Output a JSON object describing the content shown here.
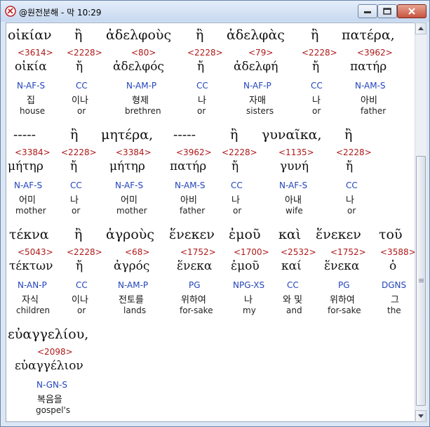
{
  "window": {
    "title": "@원전분해 - 막 10:29",
    "icons": {
      "app": "bible-app-icon",
      "min": "minimize-icon",
      "max": "maximize-icon",
      "close": "close-icon"
    }
  },
  "rows": [
    {
      "tokens": [
        {
          "greek": "οἰκίαν",
          "strong": "<3614>",
          "lemma": "οἰκία",
          "parse": "N-AF-S",
          "korean": "집",
          "english": "house"
        },
        {
          "greek": "ἢ",
          "strong": "<2228>",
          "lemma": "ἤ",
          "parse": "CC",
          "korean": "이나",
          "english": "or"
        },
        {
          "greek": "ἀδελφοὺς",
          "strong": "<80>",
          "lemma": "ἀδελφός",
          "parse": "N-AM-P",
          "korean": "형제",
          "english": "brethren"
        },
        {
          "greek": "ἢ",
          "strong": "<2228>",
          "lemma": "ἤ",
          "parse": "CC",
          "korean": "나",
          "english": "or"
        },
        {
          "greek": "ἀδελφὰς",
          "strong": "<79>",
          "lemma": "ἀδελφή",
          "parse": "N-AF-P",
          "korean": "자매",
          "english": "sisters"
        },
        {
          "greek": "ἢ",
          "strong": "<2228>",
          "lemma": "ἤ",
          "parse": "CC",
          "korean": "나",
          "english": "or"
        },
        {
          "greek": "πατέρα,",
          "strong": "<3962>",
          "lemma": "πατήρ",
          "parse": "N-AM-S",
          "korean": "아비",
          "english": "father"
        }
      ]
    },
    {
      "tokens": [
        {
          "greek": "-----",
          "strong": "<3384>",
          "lemma": "μήτηρ",
          "parse": "N-AF-S",
          "korean": "어미",
          "english": "mother"
        },
        {
          "greek": "ἢ",
          "strong": "<2228>",
          "lemma": "ἤ",
          "parse": "CC",
          "korean": "나",
          "english": "or"
        },
        {
          "greek": "μητέρα,",
          "strong": "<3384>",
          "lemma": "μήτηρ",
          "parse": "N-AF-S",
          "korean": "어미",
          "english": "mother"
        },
        {
          "greek": "-----",
          "strong": "<3962>",
          "lemma": "πατήρ",
          "parse": "N-AM-S",
          "korean": "아비",
          "english": "father"
        },
        {
          "greek": "ἢ",
          "strong": "<2228>",
          "lemma": "ἤ",
          "parse": "CC",
          "korean": "나",
          "english": "or"
        },
        {
          "greek": "γυναῖκα,",
          "strong": "<1135>",
          "lemma": "γυνή",
          "parse": "N-AF-S",
          "korean": "아내",
          "english": "wife"
        },
        {
          "greek": "ἢ",
          "strong": "<2228>",
          "lemma": "ἤ",
          "parse": "CC",
          "korean": "나",
          "english": "or"
        }
      ]
    },
    {
      "tokens": [
        {
          "greek": "τέκνα",
          "strong": "<5043>",
          "lemma": "τέκτων",
          "parse": "N-AN-P",
          "korean": "자식",
          "english": "children"
        },
        {
          "greek": "ἢ",
          "strong": "<2228>",
          "lemma": "ἤ",
          "parse": "CC",
          "korean": "이나",
          "english": "or"
        },
        {
          "greek": "ἀγροὺς",
          "strong": "<68>",
          "lemma": "ἀγρός",
          "parse": "N-AM-P",
          "korean": "전토를",
          "english": "lands"
        },
        {
          "greek": "ἕνεκεν",
          "strong": "<1752>",
          "lemma": "ἕνεκα",
          "parse": "PG",
          "korean": "위하여",
          "english": "for-sake"
        },
        {
          "greek": "ἐμοῦ",
          "strong": "<1700>",
          "lemma": "ἐμοῦ",
          "parse": "NPG-XS",
          "korean": "나",
          "english": "my"
        },
        {
          "greek": "καὶ",
          "strong": "<2532>",
          "lemma": "καί",
          "parse": "CC",
          "korean": "와 및",
          "english": "and"
        },
        {
          "greek": "ἕνεκεν",
          "strong": "<1752>",
          "lemma": "ἕνεκα",
          "parse": "PG",
          "korean": "위하여",
          "english": "for-sake"
        },
        {
          "greek": "τοῦ",
          "strong": "<3588>",
          "lemma": "ὁ",
          "parse": "DGNS",
          "korean": "그",
          "english": "the"
        }
      ]
    },
    {
      "tokens": [
        {
          "greek": "εὐαγγελίου,",
          "strong": "<2098>",
          "lemma": "εὐαγγέλιον",
          "parse": "N-GN-S",
          "korean": "복음을",
          "english": "gospel's"
        }
      ]
    }
  ]
}
